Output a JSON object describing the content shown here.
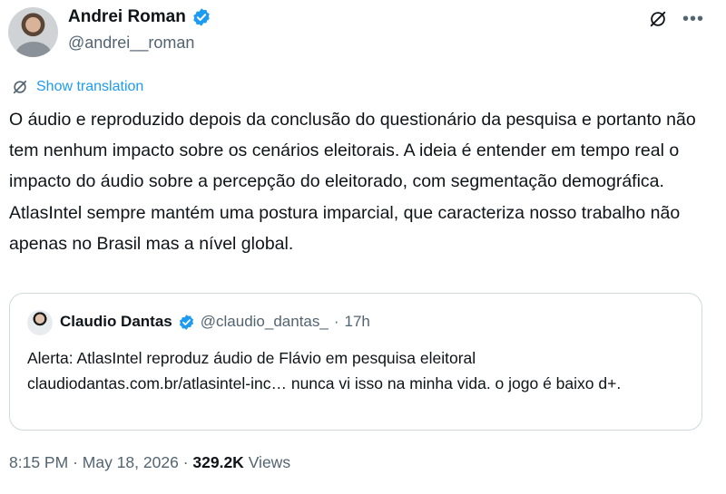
{
  "author": {
    "name": "Andrei Roman",
    "handle": "@andrei__roman"
  },
  "translation": {
    "label": "Show translation"
  },
  "tweet": {
    "text": "O áudio e reproduzido depois da conclusão do questionário da pesquisa e portanto não tem nenhum impacto sobre os cenários eleitorais. A ideia é entender em tempo real o impacto do áudio sobre a percepção do eleitorado, com segmentação demográfica. AtlasIntel sempre mantém uma postura imparcial, que caracteriza nosso trabalho não apenas no Brasil mas a nível global."
  },
  "quote": {
    "name": "Claudio Dantas",
    "handle": "@claudio_dantas_",
    "separator": "·",
    "time": "17h",
    "text": "Alerta: AtlasIntel reproduz áudio de Flávio em pesquisa eleitoral claudiodantas.com.br/atlasintel-inc… nunca vi isso na minha vida. o jogo é baixo d+."
  },
  "footer": {
    "time": "8:15 PM",
    "sep1": "·",
    "date": "May 18, 2026",
    "sep2": "·",
    "views_count": "329.2K",
    "views_label": "Views"
  },
  "colors": {
    "accent": "#1d9bf0",
    "text": "#0f1419",
    "muted": "#536471",
    "border": "#cfd9de"
  },
  "icons": {
    "verified": "verified-badge-icon",
    "grok": "grok-icon",
    "more": "more-options-icon",
    "translate": "translate-icon"
  }
}
